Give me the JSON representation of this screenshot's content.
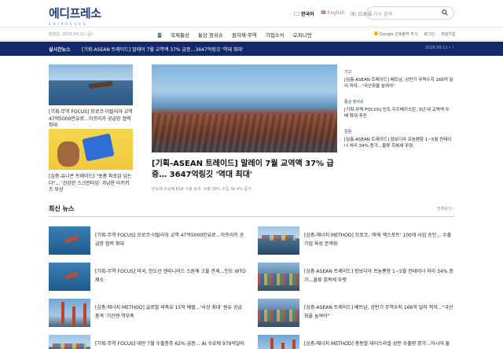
{
  "header": {
    "logo_text": "에디프레소",
    "logo_sub": "EDIPRESSO",
    "langs": [
      {
        "label": "한국어",
        "active": true
      },
      {
        "label": "English",
        "active": false
      },
      {
        "label": "日本語",
        "active": false
      }
    ],
    "search_placeholder": "기사 검색"
  },
  "nav": {
    "date": "발행일: 2026.09.11 (금)",
    "menu": [
      "홈",
      "국제통상",
      "통상 정쉬슈",
      "원자재·무역",
      "기업소식",
      "오피니언"
    ],
    "google_label": "Google 선호출처 추가",
    "login": "로그인",
    "signup": "회원가입"
  },
  "breaking": {
    "label": "실시간뉴스",
    "text": "[기획-ASEAN 트레이드] 말레이 7월 교역액 37% 급증…3647억링깃 '역대 최대'",
    "date": "2026.09.11",
    "arrows": "‹ ›"
  },
  "left_cards": [
    {
      "caption": "[기획-무역 FOCUS] 모로코·이탈리아 교역 47억5000만유로…아프리카 공급망 협력 확대"
    },
    {
      "caption": "[심층-유니콘 트레이드] \"숏폼 피로감 넘는다\"… '건강한 스크린타임' 겨냥한 아키키즈 부상"
    }
  ],
  "hero": {
    "title": "[기획-ASEAN 트레이드] 말레이 7월 교역액 37% 급증… 3647억링깃 '역대 최대'",
    "subtitle": "반도체 수요에 E&E 수출 호조. 수출 38% 수입 36.4% 증가."
  },
  "side_stories": [
    {
      "category": "기고",
      "text": "[심층-ASEAN 트레이드] 베트남, 상반기 무역수지 166억 달러 적자…\"국산화율 높여야\""
    },
    {
      "category": "통상 정쉬슈",
      "text": "[기획-무역 FOCUS] 인도·우즈베키스탄, 3년 내 교역액 두 배 확대 추진"
    },
    {
      "category": "칼럼",
      "text": "[심층-ASEAN 트레이드] 캄보디아 프놈펜항 1~5월 컨테이너 처리 34% 증가…물류 회복세 뚜렷"
    }
  ],
  "latest": {
    "title": "최신 뉴스",
    "more": "전체보기 ›",
    "items": [
      {
        "text": "[기획-무역 FOCUS] 모로코·이탈리아 교역 47억5000만유로…아프리카 공급망 협력 확대"
      },
      {
        "text": "[심층-에너지 METHOD] 모로코, '파워 엑스포트' 100개 사업 승인… 수출기업 육성 본격화"
      },
      {
        "text": "[기획-무역 FOCUS] 미국, 인도산 엔지니어드 스톤에 고율 관세…인도 WTO 제소"
      },
      {
        "text": "[심층-ASEAN 트레이드] 캄보디아 프놈펜항 1~5월 컨테이너 처리 34% 증가…물류 회복세 뚜렷"
      },
      {
        "text": "[심층-에너지 METHOD] 글로벌 비축유 15억 배럴…'사상 최대' 원유 공급 충격 '기간엔 역부족"
      },
      {
        "text": "[심층-ASEAN 트레이드] 베트남, 상반기 무역수지 166억 달러 적자…\"국산화율 높여야\""
      },
      {
        "text": "[기획-무역 FOCUS] 대만 7월 수출증주 62% 급증… AI 수요에 979억달러"
      },
      {
        "text": "[심층-에너지 METHOD] 중동발 대이스라엘 성분 수출량 증가…아시아 물"
      }
    ]
  }
}
